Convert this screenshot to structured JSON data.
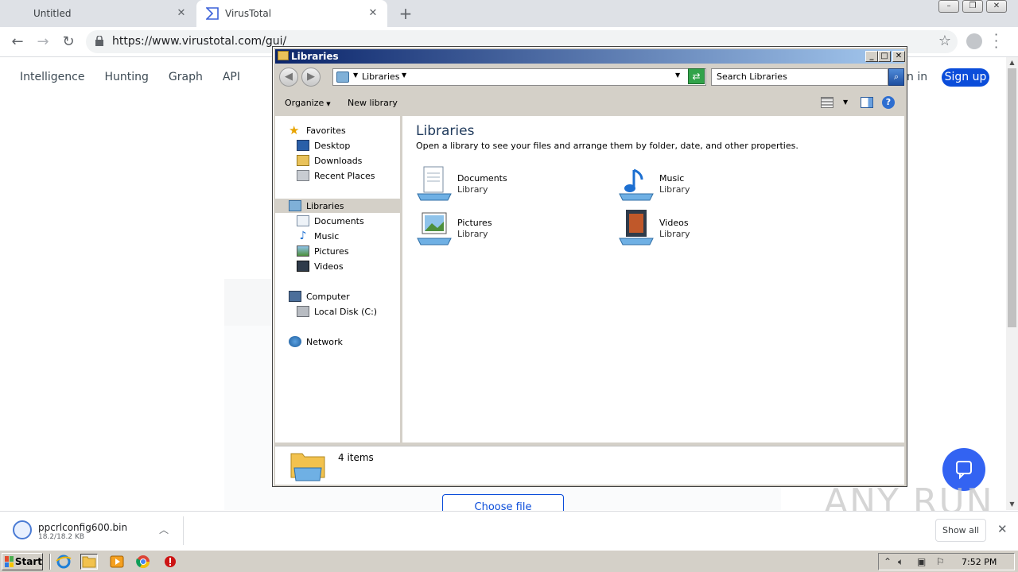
{
  "browser": {
    "tabs": [
      {
        "title": "Untitled"
      },
      {
        "title": "VirusTotal"
      }
    ],
    "url": "https://www.virustotal.com/gui/"
  },
  "vt": {
    "nav": [
      "Intelligence",
      "Hunting",
      "Graph",
      "API"
    ],
    "signin_partial": "n in",
    "signup": "Sign up",
    "choose_file": "Choose file"
  },
  "watermark": "ANY RUN",
  "download": {
    "filename": "ppcrlconfig600.bin",
    "size": "18.2/18.2 KB",
    "show_all": "Show all"
  },
  "explorer": {
    "title": "Libraries",
    "address": "Libraries",
    "search_placeholder": "Search Libraries",
    "commands": {
      "organize": "Organize",
      "new_library": "New library"
    },
    "nav": {
      "favorites": "Favorites",
      "desktop": "Desktop",
      "downloads": "Downloads",
      "recent": "Recent Places",
      "libraries": "Libraries",
      "documents": "Documents",
      "music": "Music",
      "pictures": "Pictures",
      "videos": "Videos",
      "computer": "Computer",
      "local_disk": "Local Disk (C:)",
      "network": "Network"
    },
    "content": {
      "heading": "Libraries",
      "subtitle": "Open a library to see your files and arrange them by folder, date, and other properties.",
      "items": [
        {
          "name": "Documents",
          "type": "Library"
        },
        {
          "name": "Music",
          "type": "Library"
        },
        {
          "name": "Pictures",
          "type": "Library"
        },
        {
          "name": "Videos",
          "type": "Library"
        }
      ]
    },
    "details": "4 items"
  },
  "taskbar": {
    "start": "Start",
    "clock": "7:52 PM"
  },
  "colors": {
    "vt_blue": "#0b4dda",
    "chat_blue": "#3363f2",
    "title_gradient_start": "#0a246a",
    "title_gradient_end": "#a6caf0"
  }
}
